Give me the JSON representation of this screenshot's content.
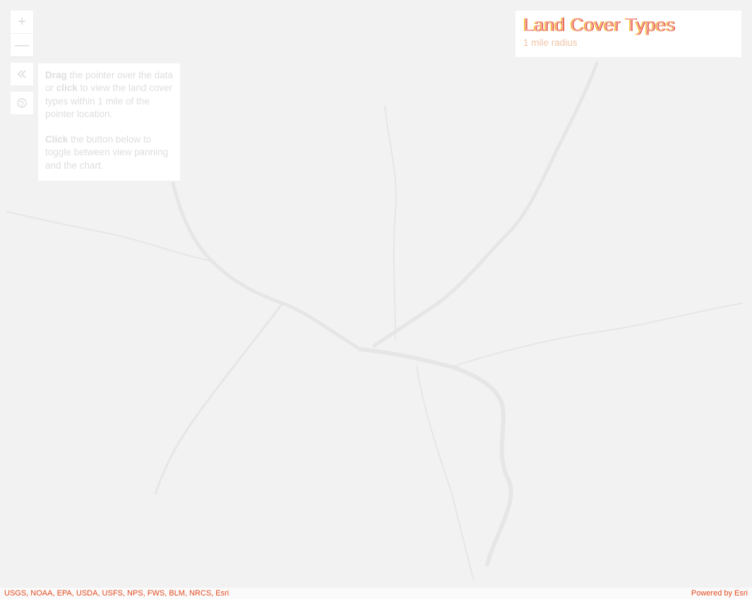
{
  "map": {
    "zoom_in_symbol": "+",
    "zoom_out_symbol": "—",
    "expand_icon": "double-chevron-left-icon",
    "toggle_icon": "globe-icon",
    "colors": {
      "background": "#f2f2f2",
      "rivers": "#e6e6e6"
    }
  },
  "instructions": {
    "p1_bold_a": "Drag",
    "p1_text_a": " the pointer over the data or ",
    "p1_bold_b": "click",
    "p1_text_b": " to view the land cover types within 1 mile of the pointer location.",
    "p2_bold": "Click",
    "p2_text": " the button below to toggle between view panning and the chart."
  },
  "legend": {
    "title": "Land Cover Types",
    "subtitle": "1 mile radius"
  },
  "attribution": {
    "sources": "USGS, NOAA, EPA, USDA, USFS, NPS, FWS, BLM, NRCS, Esri",
    "powered_by": "Powered by Esri"
  }
}
